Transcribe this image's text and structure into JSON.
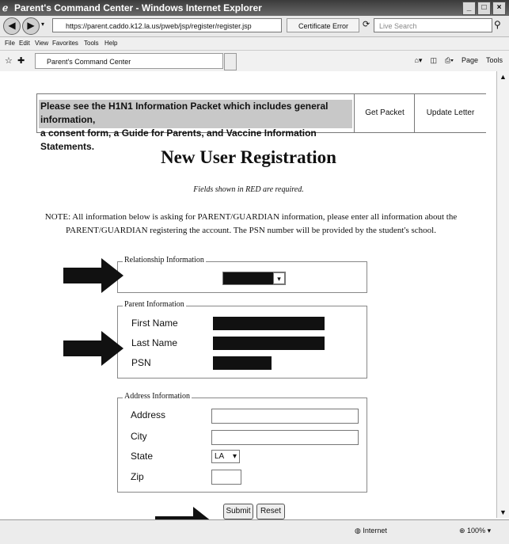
{
  "window": {
    "title": "Parent's Command Center - Windows Internet Explorer",
    "url": "https://parent.caddo.k12.la.us/pweb/jsp/register/register.jsp",
    "certificate": "Certificate Error",
    "search_placeholder": "Live Search"
  },
  "menu": [
    "File",
    "Edit",
    "View",
    "Favorites",
    "Tools",
    "Help"
  ],
  "favbar": {
    "tab_label": "Parent's Command Center",
    "page_label": "Page",
    "tools_label": "Tools"
  },
  "banner": {
    "text_line1": "Please see the H1N1 Information Packet which includes general information,",
    "text_line2": "a consent form, a Guide for Parents, and Vaccine Information Statements.",
    "get_packet": "Get Packet",
    "update_letter": "Update Letter"
  },
  "page": {
    "title": "New User Registration",
    "required_note": "Fields shown in RED are required.",
    "note_line1": "NOTE: All information below is asking for PARENT/GUARDIAN information, please enter all information about the",
    "note_line2": "PARENT/GUARDIAN registering the account. The PSN number will be provided by the student's school."
  },
  "relationship": {
    "legend": "Relationship Information"
  },
  "parent": {
    "legend": "Parent Information",
    "first_name": "First Name",
    "last_name": "Last Name",
    "psn": "PSN"
  },
  "address": {
    "legend": "Address Information",
    "address_label": "Address",
    "city_label": "City",
    "state_label": "State",
    "state_value": "LA",
    "zip_label": "Zip"
  },
  "actions": {
    "submit": "Submit",
    "reset": "Reset"
  },
  "status": {
    "zone": "Internet",
    "zoom": "100%"
  }
}
